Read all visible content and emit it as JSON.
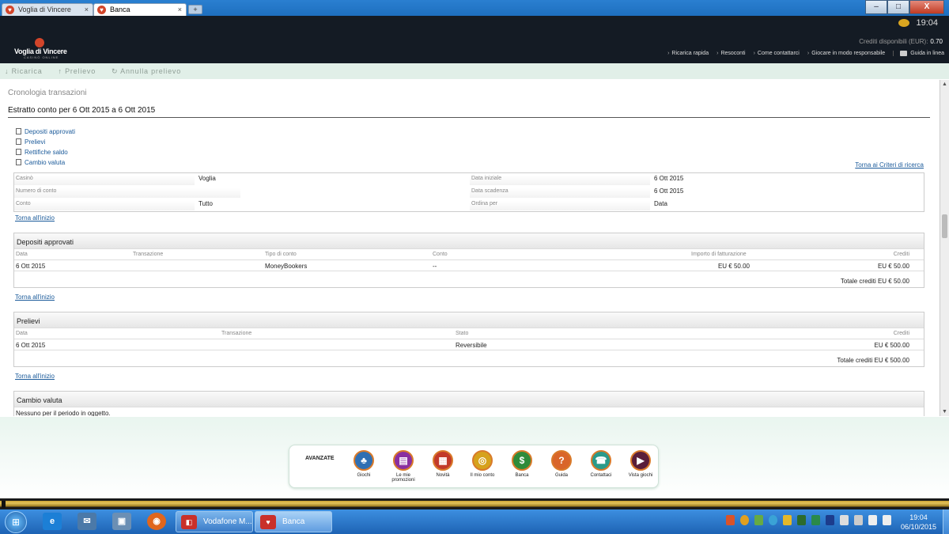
{
  "tabs": [
    {
      "label": "Voglia di Vincere"
    },
    {
      "label": "Banca"
    }
  ],
  "window": {
    "newtab": "+",
    "min": "–",
    "max": "□",
    "close": "X"
  },
  "header": {
    "clock": "19:04",
    "logo_name": "Voglia di Vincere",
    "logo_sub": "CASINÒ ONLINE",
    "credits_label": "Crediti disponibili (EUR):",
    "credits_value": "0.70",
    "nav": [
      "Ricarica rapida",
      "Resoconti",
      "Come contattarci",
      "Giocare in modo responsabile"
    ],
    "guide": "Guida in linea"
  },
  "toolbar": {
    "ricarica": "↓ Ricarica",
    "prelievo": "↑ Prelievo",
    "annulla": "↻ Annulla prelievo"
  },
  "page": {
    "breadcrumb": "Cronologia transazioni",
    "title": "Estratto conto per 6 Ott 2015 a 6 Ott 2015",
    "links": [
      "Depositi approvati",
      "Prelievi",
      "Rettifiche saldo",
      "Cambio valuta"
    ],
    "back_criteria": "Torna ai Criteri di ricerca",
    "back_top": "Torna all'inizio"
  },
  "criteria": {
    "casino_label": "Casinò",
    "casino_value": "Voglia",
    "account_label": "Numero di conto",
    "account_value": "",
    "conto_label": "Conto",
    "conto_value": "Tutto",
    "start_label": "Data iniziale",
    "start_value": "6 Ott 2015",
    "end_label": "Data scadenza",
    "end_value": "6 Ott 2015",
    "order_label": "Ordina per",
    "order_value": "Data"
  },
  "deposits": {
    "title": "Depositi approvati",
    "columns": [
      "Data",
      "Transazione",
      "Tipo di conto",
      "Conto",
      "Importo di fatturazione",
      "Crediti"
    ],
    "row": {
      "date": "6 Ott 2015",
      "transaction": "",
      "type": "MoneyBookers",
      "account": "--",
      "amount": "EU € 50.00",
      "credits": "EU € 50.00"
    },
    "total": "Totale crediti   EU € 50.00"
  },
  "withdrawals": {
    "title": "Prelievi",
    "columns": [
      "Data",
      "Transazione",
      "Stato",
      "Crediti"
    ],
    "row": {
      "date": "6 Ott 2015",
      "transaction": "",
      "status": "Reversibile",
      "credits": "EU € 500.00"
    },
    "total": "Totale crediti   EU € 500.00"
  },
  "currency": {
    "title": "Cambio valuta",
    "empty": "Nessuno per il periodo in oggetto."
  },
  "dock": {
    "label": "AVANZATE",
    "items": [
      {
        "label": "Giochi",
        "color": "#2f6fb3",
        "glyph": "♣"
      },
      {
        "label": "Le mie promozioni",
        "color": "#8a2fa0",
        "glyph": "▤"
      },
      {
        "label": "Novità",
        "color": "#c23a2a",
        "glyph": "▦"
      },
      {
        "label": "Il mio conto",
        "color": "#d6a21c",
        "glyph": "◎"
      },
      {
        "label": "Banca",
        "color": "#2e8b3a",
        "glyph": "$"
      },
      {
        "label": "Guida",
        "color": "#d9652a",
        "glyph": "?"
      },
      {
        "label": "Contattaci",
        "color": "#2a9a8a",
        "glyph": "☎"
      },
      {
        "label": "Vista giochi",
        "color": "#5a1e3a",
        "glyph": "▶"
      }
    ]
  },
  "taskbar": {
    "start": "⊞",
    "app1": "Vodafone M...",
    "app2": "Banca",
    "time": "19:04",
    "date": "06/10/2015"
  }
}
